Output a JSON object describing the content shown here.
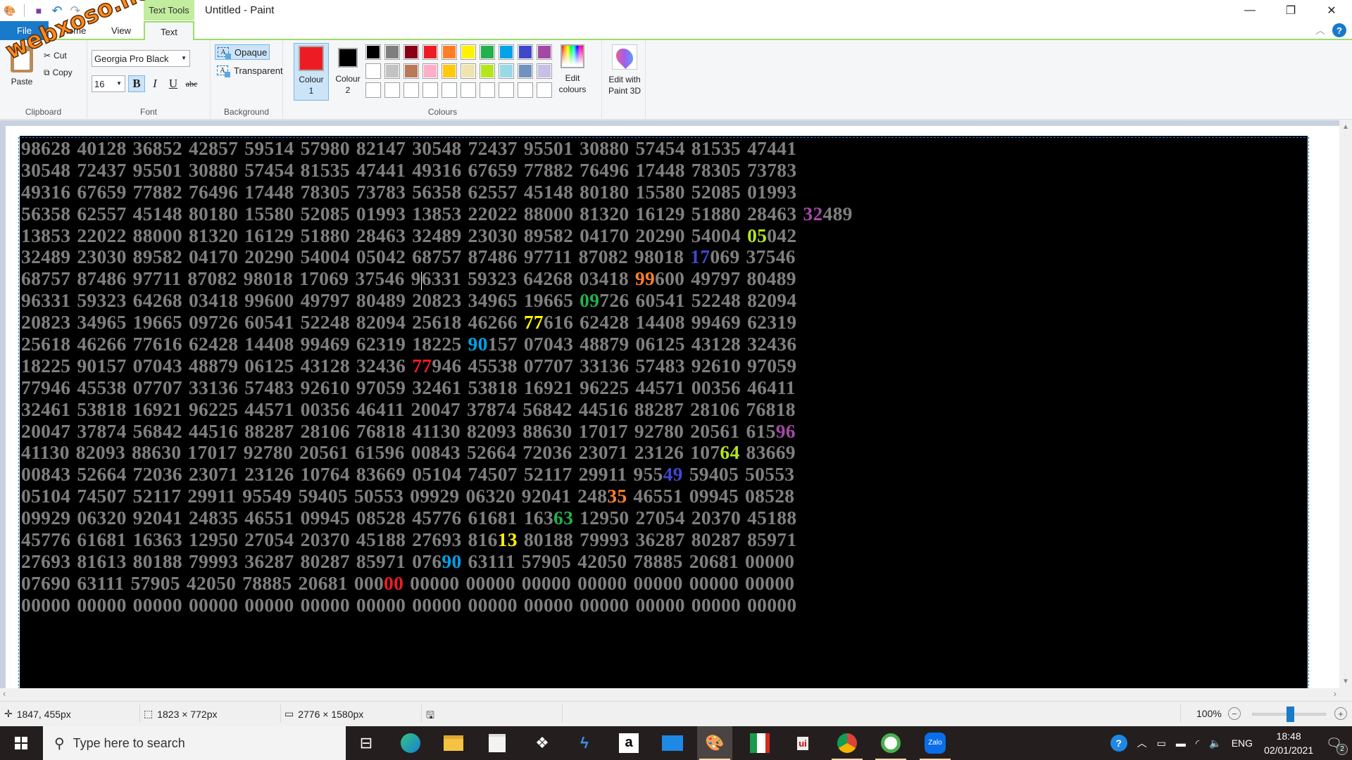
{
  "window": {
    "title": "Untitled - Paint",
    "context_tab_header": "Text Tools",
    "controls": {
      "minimize": "—",
      "restore": "❐",
      "close": "✕"
    }
  },
  "quick_access": {
    "save_icon": "💾",
    "undo_icon": "↶",
    "redo_icon": "↷",
    "customize_icon": "▾"
  },
  "watermark": "webxoso.net",
  "tabs": [
    {
      "label": "File"
    },
    {
      "label": "Home"
    },
    {
      "label": "View"
    },
    {
      "label": "Text"
    }
  ],
  "ribbon": {
    "clipboard": {
      "label": "Clipboard",
      "paste": "Paste",
      "cut": "Cut",
      "copy": "Copy"
    },
    "font": {
      "label": "Font",
      "family": "Georgia Pro Black",
      "size": "16",
      "bold": "B",
      "italic": "I",
      "underline": "U",
      "strikethrough": "abc",
      "bold_active": true
    },
    "background": {
      "label": "Background",
      "opaque": "Opaque",
      "transparent": "Transparent",
      "selected": "Opaque"
    },
    "colours": {
      "label": "Colours",
      "colour1_label": "Colour\n1",
      "colour1": "#ed1c24",
      "colour2_label": "Colour\n2",
      "colour2": "#000000",
      "palette_row1": [
        "#000000",
        "#7f7f7f",
        "#880015",
        "#ed1c24",
        "#ff7f27",
        "#fff200",
        "#22b14c",
        "#00a2e8",
        "#3f48cc",
        "#a349a4"
      ],
      "palette_row2": [
        "#ffffff",
        "#c3c3c3",
        "#b97a57",
        "#ffaec9",
        "#ffc90e",
        "#efe4b0",
        "#b5e61d",
        "#99d9ea",
        "#7092be",
        "#c8bfe7"
      ],
      "palette_row3_empty_count": 10,
      "edit_colours": "Edit colours"
    },
    "paint3d": {
      "label": "Edit with Paint 3D"
    }
  },
  "canvas": {
    "text_color": "#7f7f7f",
    "background_color": "#000000",
    "rows": [
      [
        "98628",
        "40128",
        "36852",
        "42857",
        "59514",
        "57980",
        "82147",
        "30548",
        "72437",
        "95501",
        "30880",
        "57454",
        "81535",
        "47441"
      ],
      [
        "30548",
        "72437",
        "95501",
        "30880",
        "57454",
        "81535",
        "47441",
        "49316",
        "67659",
        "77882",
        "76496",
        "17448",
        "78305",
        "73783"
      ],
      [
        "49316",
        "67659",
        "77882",
        "76496",
        "17448",
        "78305",
        "73783",
        "56358",
        "62557",
        "45148",
        "80180",
        "15580",
        "52085",
        "01993"
      ],
      [
        "56358",
        "62557",
        "45148",
        "80180",
        "15580",
        "52085",
        "01993",
        "13853",
        "22022",
        "88000",
        "81320",
        "16129",
        "51880",
        "28463",
        "32489"
      ],
      [
        "13853",
        "22022",
        "88000",
        "81320",
        "16129",
        "51880",
        "28463",
        "32489",
        "23030",
        "89582",
        "04170",
        "20290",
        "54004",
        "05042"
      ],
      [
        "32489",
        "23030",
        "89582",
        "04170",
        "20290",
        "54004",
        "05042",
        "68757",
        "87486",
        "97711",
        "87082",
        "98018",
        "17069",
        "37546"
      ],
      [
        "68757",
        "87486",
        "97711",
        "87082",
        "98018",
        "17069",
        "37546",
        "96331",
        "59323",
        "64268",
        "03418",
        "99600",
        "49797",
        "80489"
      ],
      [
        "96331",
        "59323",
        "64268",
        "03418",
        "99600",
        "49797",
        "80489",
        "20823",
        "34965",
        "19665",
        "09726",
        "60541",
        "52248",
        "82094"
      ],
      [
        "20823",
        "34965",
        "19665",
        "09726",
        "60541",
        "52248",
        "82094",
        "25618",
        "46266",
        "77616",
        "62428",
        "14408",
        "99469",
        "62319"
      ],
      [
        "25618",
        "46266",
        "77616",
        "62428",
        "14408",
        "99469",
        "62319",
        "18225",
        "90157",
        "07043",
        "48879",
        "06125",
        "43128",
        "32436"
      ],
      [
        "18225",
        "90157",
        "07043",
        "48879",
        "06125",
        "43128",
        "32436",
        "77946",
        "45538",
        "07707",
        "33136",
        "57483",
        "92610",
        "97059"
      ],
      [
        "77946",
        "45538",
        "07707",
        "33136",
        "57483",
        "92610",
        "97059",
        "32461",
        "53818",
        "16921",
        "96225",
        "44571",
        "00356",
        "46411"
      ],
      [
        "32461",
        "53818",
        "16921",
        "96225",
        "44571",
        "00356",
        "46411",
        "20047",
        "37874",
        "56842",
        "44516",
        "88287",
        "28106",
        "76818"
      ],
      [
        "20047",
        "37874",
        "56842",
        "44516",
        "88287",
        "28106",
        "76818",
        "41130",
        "82093",
        "88630",
        "17017",
        "92780",
        "20561",
        "61596"
      ],
      [
        "41130",
        "82093",
        "88630",
        "17017",
        "92780",
        "20561",
        "61596",
        "00843",
        "52664",
        "72036",
        "23071",
        "23126",
        "10764",
        "83669"
      ],
      [
        "00843",
        "52664",
        "72036",
        "23071",
        "23126",
        "10764",
        "83669",
        "05104",
        "74507",
        "52117",
        "29911",
        "95549",
        "59405",
        "50553"
      ],
      [
        "05104",
        "74507",
        "52117",
        "29911",
        "95549",
        "59405",
        "50553",
        "09929",
        "06320",
        "92041",
        "24835",
        "46551",
        "09945",
        "08528"
      ],
      [
        "09929",
        "06320",
        "92041",
        "24835",
        "46551",
        "09945",
        "08528",
        "45776",
        "61681",
        "16363",
        "12950",
        "27054",
        "20370",
        "45188"
      ],
      [
        "45776",
        "61681",
        "16363",
        "12950",
        "27054",
        "20370",
        "45188",
        "27693",
        "81613",
        "80188",
        "79993",
        "36287",
        "80287",
        "85971"
      ],
      [
        "27693",
        "81613",
        "80188",
        "79993",
        "36287",
        "80287",
        "85971",
        "07690",
        "63111",
        "57905",
        "42050",
        "78885",
        "20681",
        "00000"
      ],
      [
        "07690",
        "63111",
        "57905",
        "42050",
        "78885",
        "20681",
        "00000",
        "00000",
        "00000",
        "00000",
        "00000",
        "00000",
        "00000",
        "00000"
      ],
      [
        "00000",
        "00000",
        "00000",
        "00000",
        "00000",
        "00000",
        "00000",
        "00000",
        "00000",
        "00000",
        "00000",
        "00000",
        "00000",
        "00000"
      ]
    ],
    "highlights": [
      {
        "row": 3,
        "col": 14,
        "start": 0,
        "len": 2,
        "color": "#a349a4"
      },
      {
        "row": 4,
        "col": 13,
        "start": 0,
        "len": 2,
        "color": "#b5e61d"
      },
      {
        "row": 5,
        "col": 12,
        "start": 0,
        "len": 2,
        "color": "#3f48cc"
      },
      {
        "row": 6,
        "col": 11,
        "start": 0,
        "len": 2,
        "color": "#ff7f27"
      },
      {
        "row": 7,
        "col": 10,
        "start": 0,
        "len": 2,
        "color": "#22b14c"
      },
      {
        "row": 8,
        "col": 9,
        "start": 0,
        "len": 2,
        "color": "#fff200"
      },
      {
        "row": 9,
        "col": 8,
        "start": 0,
        "len": 2,
        "color": "#00a2e8"
      },
      {
        "row": 10,
        "col": 7,
        "start": 0,
        "len": 2,
        "color": "#ed1c24"
      },
      {
        "row": 13,
        "col": 13,
        "start": 3,
        "len": 2,
        "color": "#a349a4"
      },
      {
        "row": 14,
        "col": 12,
        "start": 3,
        "len": 2,
        "color": "#b5e61d"
      },
      {
        "row": 15,
        "col": 11,
        "start": 3,
        "len": 2,
        "color": "#3f48cc"
      },
      {
        "row": 16,
        "col": 10,
        "start": 3,
        "len": 2,
        "color": "#ff7f27"
      },
      {
        "row": 17,
        "col": 9,
        "start": 3,
        "len": 2,
        "color": "#22b14c"
      },
      {
        "row": 18,
        "col": 8,
        "start": 3,
        "len": 2,
        "color": "#fff200"
      },
      {
        "row": 19,
        "col": 7,
        "start": 3,
        "len": 2,
        "color": "#00a2e8"
      },
      {
        "row": 20,
        "col": 6,
        "start": 3,
        "len": 2,
        "color": "#ed1c24"
      }
    ],
    "text_cursor": {
      "row": 6,
      "col": 7,
      "after_char": 1
    }
  },
  "statusbar": {
    "cursor_position": "1847, 455px",
    "selection_size": "1823 × 772px",
    "image_size": "2776 × 1580px",
    "zoom": "100%",
    "zoom_level_percent": 100
  },
  "taskbar": {
    "search_placeholder": "Type here to search",
    "apps": [
      "Task View",
      "Microsoft Edge",
      "File Explorer",
      "Microsoft Store",
      "Dropbox",
      "Visual Studio",
      "Amazon",
      "Mail",
      "Paint",
      "Foxit Reader",
      "UniKey",
      "Google Chrome",
      "Coc Coc",
      "Zalo"
    ],
    "active_app": "Paint",
    "tray": {
      "language": "ENG",
      "time": "18:48",
      "date": "02/01/2021",
      "notifications": "2"
    }
  }
}
